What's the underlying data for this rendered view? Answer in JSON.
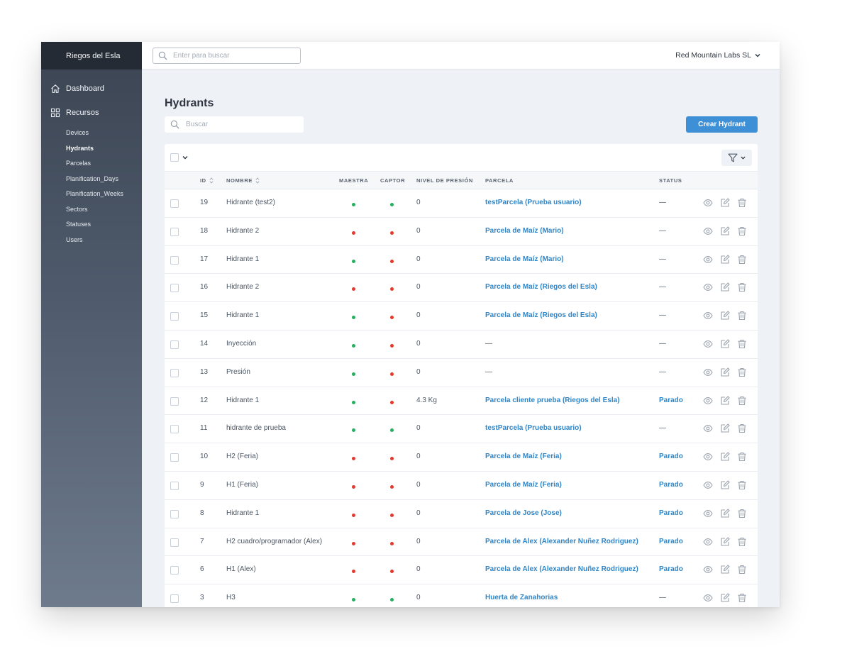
{
  "app": {
    "brand": "Riegos del Esla",
    "organization": "Red Mountain Labs SL"
  },
  "topbar": {
    "search_placeholder": "Enter para buscar"
  },
  "sidebar": {
    "main": [
      {
        "label": "Dashboard",
        "icon": "home-icon"
      },
      {
        "label": "Recursos",
        "icon": "grid-icon"
      }
    ],
    "resources": [
      "Devices",
      "Hydrants",
      "Parcelas",
      "Planification_Days",
      "Planification_Weeks",
      "Sectors",
      "Statuses",
      "Users"
    ],
    "active": "Hydrants"
  },
  "page": {
    "title": "Hydrants",
    "search_placeholder": "Buscar",
    "create_label": "Crear Hydrant"
  },
  "table": {
    "headers": {
      "id": "ID",
      "nombre": "NOMBRE",
      "maestra": "MAESTRA",
      "captor": "CAPTOR",
      "presion": "NIVEL DE PRESIÓN",
      "parcela": "PARCELA",
      "status": "STATUS"
    },
    "rows": [
      {
        "id": "19",
        "nombre": "Hidrante (test2)",
        "maestra": "green",
        "captor": "green",
        "presion": "0",
        "parcela": "testParcela (Prueba usuario)",
        "status": "—"
      },
      {
        "id": "18",
        "nombre": "Hidrante 2",
        "maestra": "red",
        "captor": "red",
        "presion": "0",
        "parcela": "Parcela de Maíz (Mario)",
        "status": "—"
      },
      {
        "id": "17",
        "nombre": "Hidrante 1",
        "maestra": "green",
        "captor": "red",
        "presion": "0",
        "parcela": "Parcela de Maíz (Mario)",
        "status": "—"
      },
      {
        "id": "16",
        "nombre": "Hidrante 2",
        "maestra": "red",
        "captor": "red",
        "presion": "0",
        "parcela": "Parcela de Maíz (Riegos del Esla)",
        "status": "—"
      },
      {
        "id": "15",
        "nombre": "Hidrante 1",
        "maestra": "green",
        "captor": "red",
        "presion": "0",
        "parcela": "Parcela de Maíz (Riegos del Esla)",
        "status": "—"
      },
      {
        "id": "14",
        "nombre": "Inyección",
        "maestra": "green",
        "captor": "red",
        "presion": "0",
        "parcela": "—",
        "status": "—"
      },
      {
        "id": "13",
        "nombre": "Presión",
        "maestra": "green",
        "captor": "red",
        "presion": "0",
        "parcela": "—",
        "status": "—"
      },
      {
        "id": "12",
        "nombre": "Hidrante 1",
        "maestra": "green",
        "captor": "red",
        "presion": "4.3 Kg",
        "parcela": "Parcela cliente prueba (Riegos del Esla)",
        "status": "Parado"
      },
      {
        "id": "11",
        "nombre": "hidrante de prueba",
        "maestra": "green",
        "captor": "green",
        "presion": "0",
        "parcela": "testParcela (Prueba usuario)",
        "status": "—"
      },
      {
        "id": "10",
        "nombre": "H2 (Feria)",
        "maestra": "red",
        "captor": "red",
        "presion": "0",
        "parcela": "Parcela de Maíz (Feria)",
        "status": "Parado"
      },
      {
        "id": "9",
        "nombre": "H1 (Feria)",
        "maestra": "red",
        "captor": "red",
        "presion": "0",
        "parcela": "Parcela de Maíz (Feria)",
        "status": "Parado"
      },
      {
        "id": "8",
        "nombre": "Hidrante 1",
        "maestra": "red",
        "captor": "red",
        "presion": "0",
        "parcela": "Parcela de Jose (Jose)",
        "status": "Parado"
      },
      {
        "id": "7",
        "nombre": "H2 cuadro/programador (Alex)",
        "maestra": "red",
        "captor": "red",
        "presion": "0",
        "parcela": "Parcela de Alex (Alexander Nuñez Rodriguez)",
        "status": "Parado"
      },
      {
        "id": "6",
        "nombre": "H1 (Alex)",
        "maestra": "red",
        "captor": "red",
        "presion": "0",
        "parcela": "Parcela de Alex (Alexander Nuñez Rodriguez)",
        "status": "Parado"
      },
      {
        "id": "3",
        "nombre": "H3",
        "maestra": "green",
        "captor": "green",
        "presion": "0",
        "parcela": "Huerta de Zanahorias",
        "status": "—"
      }
    ]
  },
  "colors": {
    "accent": "#3d8fd6",
    "link": "#2e86c9",
    "dot_green": "#27ae60",
    "dot_red": "#e03b2e"
  }
}
